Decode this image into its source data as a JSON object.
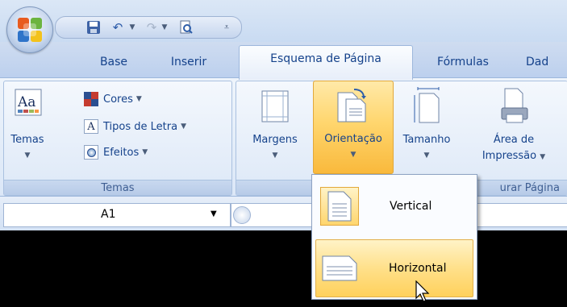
{
  "tabs": [
    "Base",
    "Inserir",
    "Esquema de Página",
    "Fórmulas",
    "Dad"
  ],
  "ribbon": {
    "temas_group": {
      "label": "Temas",
      "temas_button": "Temas",
      "cores": "Cores",
      "tipos_de_letra": "Tipos de Letra",
      "efeitos": "Efeitos"
    },
    "page_setup_group": {
      "label": "urar Página",
      "margens": "Margens",
      "orientacao": "Orientação",
      "tamanho": "Tamanho",
      "area_line1": "Área de",
      "area_line2": "Impressão"
    }
  },
  "namebox": {
    "value": "A1"
  },
  "orientation_menu": {
    "items": [
      {
        "label": "Vertical"
      },
      {
        "label": "Horizontal",
        "hovered": true
      }
    ]
  },
  "colors": {
    "ribbon_blue": "#15428b",
    "hover_orange": "#ffd66e"
  }
}
